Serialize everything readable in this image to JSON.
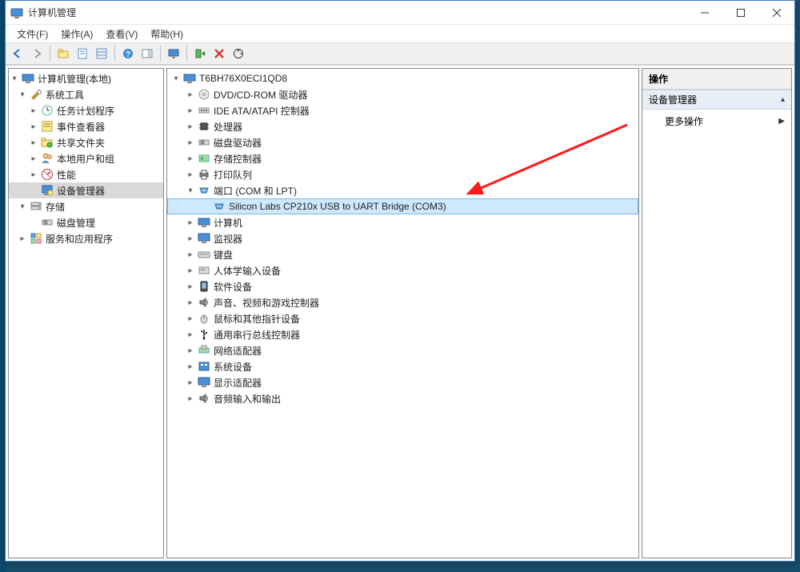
{
  "window": {
    "title": "计算机管理"
  },
  "menubar": {
    "file": "文件(F)",
    "action": "操作(A)",
    "view": "查看(V)",
    "help": "帮助(H)"
  },
  "toolbar": {
    "back": "back-icon",
    "forward": "forward-icon",
    "up": "up-folder-icon",
    "props": "properties-icon",
    "list": "list-view-icon",
    "help": "help-icon",
    "pane": "pane-icon",
    "monitor": "monitor-icon",
    "legacy": "enable-device-icon",
    "delete": "delete-icon",
    "refreshhw": "scan-hardware-icon"
  },
  "left_tree": {
    "root": "计算机管理(本地)",
    "system_tools": "系统工具",
    "task_scheduler": "任务计划程序",
    "event_viewer": "事件查看器",
    "shared_folders": "共享文件夹",
    "local_users": "本地用户和组",
    "performance": "性能",
    "device_manager": "设备管理器",
    "storage": "存储",
    "disk_mgmt": "磁盘管理",
    "services_apps": "服务和应用程序"
  },
  "mid_tree": {
    "computer": "T6BH76X0ECI1QD8",
    "dvd": "DVD/CD-ROM 驱动器",
    "ide": "IDE ATA/ATAPI 控制器",
    "cpu": "处理器",
    "diskdrive": "磁盘驱动器",
    "storctrl": "存储控制器",
    "printq": "打印队列",
    "ports": "端口 (COM 和 LPT)",
    "port_child": "Silicon Labs CP210x USB to UART Bridge (COM3)",
    "computers": "计算机",
    "monitors": "监视器",
    "keyboard": "键盘",
    "hid": "人体学输入设备",
    "softdev": "软件设备",
    "sound": "声音、视频和游戏控制器",
    "mouse": "鼠标和其他指针设备",
    "usb": "通用串行总线控制器",
    "network": "网络适配器",
    "sysdev": "系统设备",
    "display": "显示适配器",
    "audio": "音频输入和输出"
  },
  "right_pane": {
    "header": "操作",
    "section": "设备管理器",
    "more_actions": "更多操作"
  }
}
